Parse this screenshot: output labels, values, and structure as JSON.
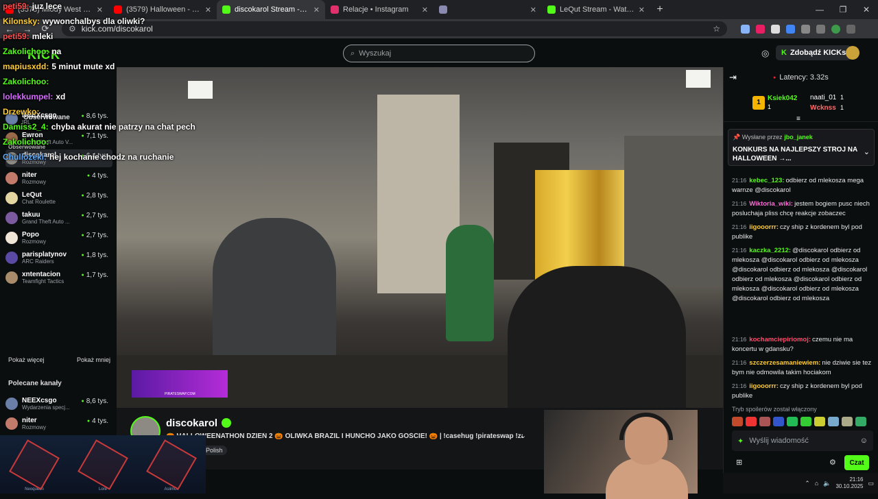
{
  "browser": {
    "tabs": [
      {
        "title": "(3578) Młody West - Tak Już By",
        "color": "#ff0000",
        "active": false
      },
      {
        "title": "(3579) Halloween - YouTube",
        "color": "#ff0000",
        "active": false
      },
      {
        "title": "discokarol Stream - Watch",
        "color": "#53fc18",
        "active": true
      },
      {
        "title": "Relacje • Instagram",
        "color": "#e1306c",
        "active": false
      },
      {
        "title": "",
        "color": "#8a8ab0",
        "active": false
      },
      {
        "title": "LeQut Stream - Watch Live on",
        "color": "#53fc18",
        "active": false
      }
    ],
    "new_tab": "+",
    "url": "kick.com/discokarol"
  },
  "kick": {
    "logo": "KICK",
    "search_placeholder": "Wyszukaj",
    "get_kicks": "Zdobądź KICKs"
  },
  "overlay_chat": [
    {
      "user": "peti59:",
      "text": "juz lece",
      "color": "#ff4d4d"
    },
    {
      "user": "Kilonsky:",
      "text": "wywonchalbys dla oliwki?",
      "color": "#ffcc33"
    },
    {
      "user": "peti59:",
      "text": "mleki",
      "color": "#ff4d4d"
    },
    {
      "user": "Zakolichoo:",
      "text": "na",
      "color": "#53fc18"
    },
    {
      "user": "mapiusxdd:",
      "text": "5 minut mute xd",
      "color": "#ffcc33"
    },
    {
      "user": "Zakolichoo:",
      "text": "",
      "color": "#53fc18"
    },
    {
      "user": "lolekkumpel:",
      "text": "xd",
      "color": "#d66bff"
    },
    {
      "user": "Drzewko:",
      "text": "",
      "color": "#ffcc33"
    },
    {
      "user": "Damiss2_4:",
      "text": "chyba akurat nie patrzy na chat pech",
      "color": "#53fc18"
    },
    {
      "user": "Zakolichoo:",
      "text": "",
      "color": "#53fc18"
    },
    {
      "user": "Chuliozeki:",
      "text": "hej kochanie chodz na ruchanie",
      "color": "#5aa9ff"
    }
  ],
  "sidebar": {
    "under_overlay": [
      {
        "label": "Obserwowane"
      },
      {
        "label": "Obserwowane"
      }
    ],
    "channels": [
      {
        "name": "NEEXcsgo",
        "sub": "IRL",
        "viewers": "8,6 tys.",
        "color": "#6a7fa8"
      },
      {
        "name": "Ewron",
        "sub": "Grand Theft Auto V...",
        "viewers": "7,1 tys.",
        "color": "#9a6a4a"
      },
      {
        "name": "discokarol",
        "sub": "Rozmowy",
        "viewers": "6,4 tys.",
        "color": "#8d8a84"
      },
      {
        "name": "niter",
        "sub": "Rozmowy",
        "viewers": "4 tys.",
        "color": "#c27b6a"
      },
      {
        "name": "LeQut",
        "sub": "Chat Roulette",
        "viewers": "2,8 tys.",
        "color": "#e3d6a0"
      },
      {
        "name": "takuu",
        "sub": "Grand Theft Auto ...",
        "viewers": "2,7 tys.",
        "color": "#7c5aa0"
      },
      {
        "name": "Popo",
        "sub": "Rozmowy",
        "viewers": "2,7 tys.",
        "color": "#f0e6d8"
      },
      {
        "name": "parisplatynov",
        "sub": "ARC Raiders",
        "viewers": "1,8 tys.",
        "color": "#5b4aa3"
      },
      {
        "name": "xntentacion",
        "sub": "Teamfight Tactics",
        "viewers": "1,7 tys.",
        "color": "#a88b6a"
      }
    ],
    "show_more": "Pokaż więcej",
    "show_less": "Pokaż mniej",
    "recommended_title": "Polecane kanały",
    "recommended": [
      {
        "name": "NEEXcsgo",
        "sub": "Wydarzenia specj...",
        "viewers": "8,6 tys.",
        "color": "#6a7fa8"
      },
      {
        "name": "niter",
        "sub": "Rozmowy",
        "viewers": "4 tys.",
        "color": "#c27b6a"
      }
    ]
  },
  "stream": {
    "channel": "discokarol",
    "title": "🎃 HALLOWEENATHON DZIEŃ 2 🎃 OLIWKA BRAZIL I HUNCHO JAKO GOŚCIE! 🎃 | !casehug !pirateswap !zara...",
    "tag": "Polish",
    "banner_text": "PIRATESWAP.COM"
  },
  "skins": [
    {
      "label": "Neoqueen"
    },
    {
      "label": "Lore"
    },
    {
      "label": "Asiimov"
    }
  ],
  "chat": {
    "latency": "Latency: 3.32s",
    "leaderboard": [
      {
        "rank": "1",
        "name": "Ksiek042",
        "count": "1"
      },
      {
        "name": "naati_01",
        "count": "1"
      },
      {
        "name": "Wcknss",
        "count": "1"
      }
    ],
    "pinned_by_label": "Wysłane przez",
    "pinned_by_user": "jbo_janek",
    "pinned_text": "KONKURS NA NAJLEPSZY STROJ NA HALLOWEEN →...",
    "messages": [
      {
        "time": "21:16",
        "user": "kebec_123:",
        "color": "#53fc18",
        "text": "odbierz od mlekosza mega warnze @discokarol"
      },
      {
        "time": "21:16",
        "user": "Wiktoria_wiki:",
        "color": "#ff6bd6",
        "text": "jestem bogiem pusc niech posluchaja pliss chcę reakcje zobaczec"
      },
      {
        "time": "21:16",
        "user": "iigooorrr:",
        "color": "#ffcc33",
        "text": "czy ship z kordenem byl pod publike"
      },
      {
        "time": "21:16",
        "user": "kaczka_2212:",
        "color": "#53fc18",
        "text": "@discokarol odbierz od mlekosza @discokarol odbierz od mlekosza @discokarol odbierz od mlekosza @discokarol odbierz od mlekosza @discokarol odbierz od mlekosza @discokarol odbierz od mlekosza @discokarol odbierz od mlekosza"
      },
      {
        "time": "21:16",
        "user": "kochamciepiriomoj:",
        "color": "#ff4d6d",
        "text": "czemu nie ma koncertu w gdansku?"
      },
      {
        "time": "21:16",
        "user": "szczerzesamaniewiem:",
        "color": "#ffcc33",
        "text": "nie dziwie sie tez bym nie odmowila takim hociakom"
      },
      {
        "time": "21:16",
        "user": "iigooorrr:",
        "color": "#ffcc33",
        "text": "czy ship z kordenem byl pod publike"
      }
    ],
    "spoiler_notice": "Tryb spoilerów został włączony",
    "input_placeholder": "Wyślij wiadomość",
    "send_label": "Czat"
  },
  "taskbar": {
    "time": "21:16",
    "date": "30.10.2025"
  }
}
